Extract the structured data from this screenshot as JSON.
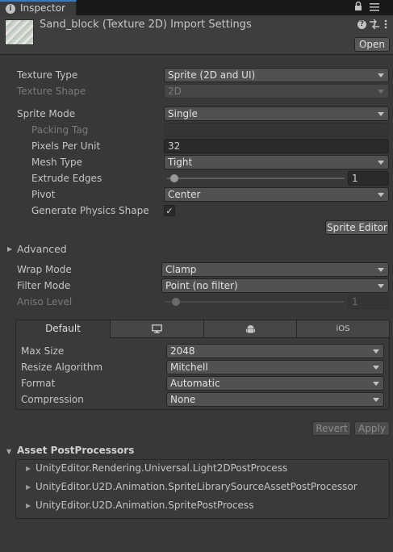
{
  "tab": {
    "title": "Inspector",
    "icon": "info-icon"
  },
  "tab_icons": [
    "lock-icon",
    "menu-icon"
  ],
  "header": {
    "title": "Sand_block (Texture 2D) Import Settings",
    "open_label": "Open",
    "icons": [
      "help-icon",
      "preset-icon",
      "more-icon"
    ]
  },
  "settings": {
    "texture_type": {
      "label": "Texture Type",
      "value": "Sprite (2D and UI)"
    },
    "texture_shape": {
      "label": "Texture Shape",
      "value": "2D"
    },
    "sprite_mode": {
      "label": "Sprite Mode",
      "value": "Single"
    },
    "packing_tag": {
      "label": "Packing Tag",
      "value": ""
    },
    "pixels_per_unit": {
      "label": "Pixels Per Unit",
      "value": "32"
    },
    "mesh_type": {
      "label": "Mesh Type",
      "value": "Tight"
    },
    "extrude_edges": {
      "label": "Extrude Edges",
      "value": "1"
    },
    "pivot": {
      "label": "Pivot",
      "value": "Center"
    },
    "generate_physics_shape": {
      "label": "Generate Physics Shape",
      "checked": true,
      "mark": "✓"
    },
    "sprite_editor_label": "Sprite Editor",
    "advanced_label": "Advanced",
    "wrap_mode": {
      "label": "Wrap Mode",
      "value": "Clamp"
    },
    "filter_mode": {
      "label": "Filter Mode",
      "value": "Point (no filter)"
    },
    "aniso_level": {
      "label": "Aniso Level",
      "value": "1"
    }
  },
  "platform": {
    "tabs": [
      {
        "label": "Default",
        "icon": ""
      },
      {
        "label": "",
        "icon": "monitor-icon"
      },
      {
        "label": "",
        "icon": "android-icon"
      },
      {
        "label": "iOS",
        "icon": ""
      }
    ],
    "max_size": {
      "label": "Max Size",
      "value": "2048"
    },
    "resize_algorithm": {
      "label": "Resize Algorithm",
      "value": "Mitchell"
    },
    "format": {
      "label": "Format",
      "value": "Automatic"
    },
    "compression": {
      "label": "Compression",
      "value": "None"
    }
  },
  "actions": {
    "revert": "Revert",
    "apply": "Apply"
  },
  "postprocessors": {
    "title": "Asset PostProcessors",
    "items": [
      "UnityEditor.Rendering.Universal.Light2DPostProcess",
      "UnityEditor.U2D.Animation.SpriteLibrarySourceAssetPostProcessor",
      "UnityEditor.U2D.Animation.SpritePostProcess"
    ]
  },
  "colors": {
    "accent": "#3a79bb",
    "background": "#383838"
  }
}
